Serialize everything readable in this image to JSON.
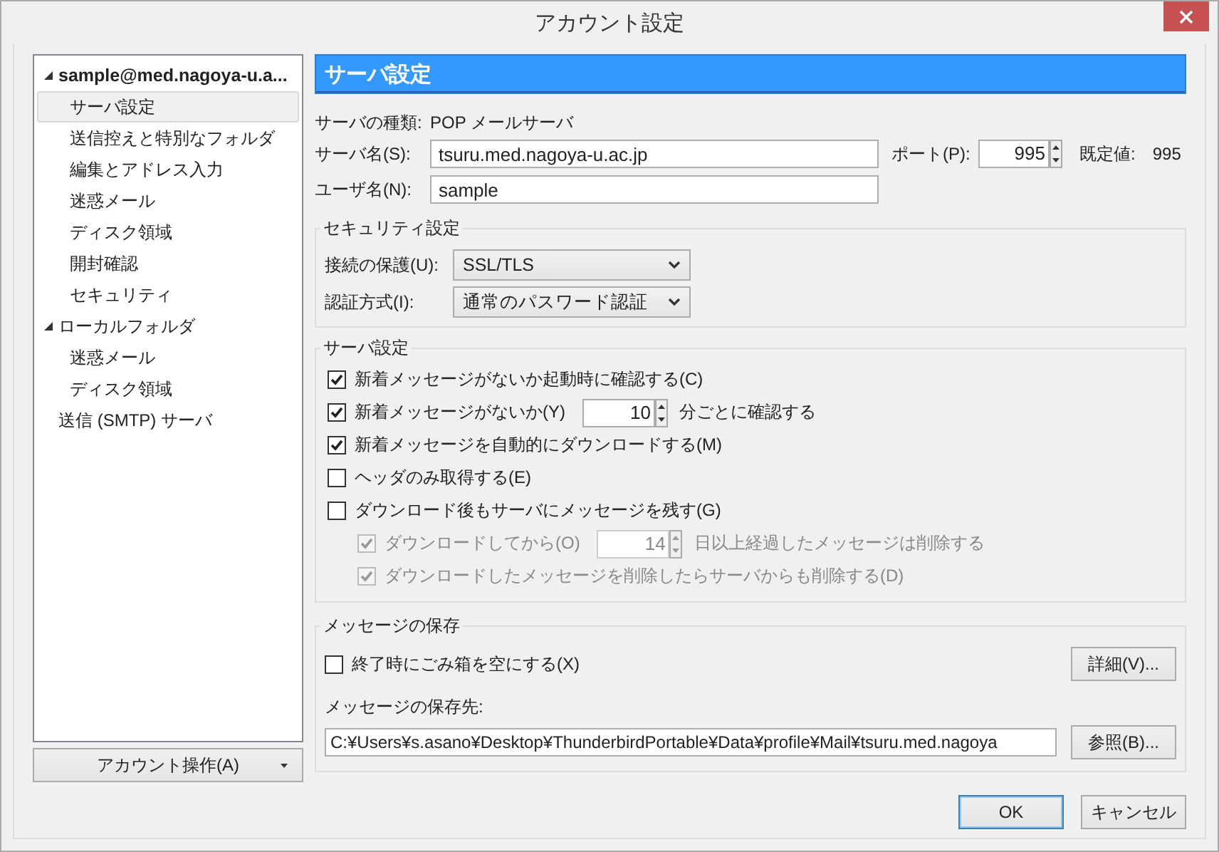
{
  "window": {
    "title": "アカウント設定"
  },
  "tree": [
    {
      "label": "sample@med.nagoya-u.a...",
      "kind": "account",
      "expanded": true,
      "selected": false,
      "children": [
        {
          "label": "サーバ設定",
          "selected": true
        },
        {
          "label": "送信控えと特別なフォルダ",
          "selected": false
        },
        {
          "label": "編集とアドレス入力",
          "selected": false
        },
        {
          "label": "迷惑メール",
          "selected": false
        },
        {
          "label": "ディスク領域",
          "selected": false
        },
        {
          "label": "開封確認",
          "selected": false
        },
        {
          "label": "セキュリティ",
          "selected": false
        }
      ]
    },
    {
      "label": "ローカルフォルダ",
      "kind": "folder",
      "expanded": true,
      "selected": false,
      "children": [
        {
          "label": "迷惑メール",
          "selected": false
        },
        {
          "label": "ディスク領域",
          "selected": false
        }
      ]
    },
    {
      "label": "送信 (SMTP) サーバ",
      "kind": "folder",
      "selected": false
    }
  ],
  "account_actions_button": "アカウント操作(A)",
  "header": "サーバ設定",
  "server_type": {
    "label": "サーバの種類:",
    "value": "POP メールサーバ"
  },
  "server_name": {
    "label": "サーバ名(S):",
    "value": "tsuru.med.nagoya-u.ac.jp"
  },
  "port": {
    "label": "ポート(P):",
    "value": "995",
    "default_label": "既定値:",
    "default_value": "995"
  },
  "user_name": {
    "label": "ユーザ名(N):",
    "value": "sample"
  },
  "security": {
    "title": "セキュリティ設定",
    "fields": [
      {
        "label": "接続の保護(U):",
        "value": "SSL/TLS"
      },
      {
        "label": "認証方式(I):",
        "value": "通常のパスワード認証"
      }
    ]
  },
  "server_settings": {
    "title": "サーバ設定",
    "options": [
      {
        "kind": "check",
        "label": "新着メッセージがないか起動時に確認する(C)",
        "checked": true,
        "disabled": false
      },
      {
        "kind": "spin",
        "label": "新着メッセージがないか(Y)",
        "checked": true,
        "disabled": false,
        "value": "10",
        "suffix": "分ごとに確認する"
      },
      {
        "kind": "check",
        "label": "新着メッセージを自動的にダウンロードする(M)",
        "checked": true,
        "disabled": false
      },
      {
        "kind": "check",
        "label": "ヘッダのみ取得する(E)",
        "checked": false,
        "disabled": false
      },
      {
        "kind": "check",
        "label": "ダウンロード後もサーバにメッセージを残す(G)",
        "checked": false,
        "disabled": false,
        "children": [
          {
            "kind": "spin",
            "label": "ダウンロードしてから(O)",
            "checked": true,
            "disabled": true,
            "value": "14",
            "suffix": "日以上経過したメッセージは削除する"
          },
          {
            "kind": "check",
            "label": "ダウンロードしたメッセージを削除したらサーバからも削除する(D)",
            "checked": true,
            "disabled": true
          }
        ]
      }
    ]
  },
  "message_storage": {
    "title": "メッセージの保存",
    "empty_trash": {
      "label": "終了時にごみ箱を空にする(X)",
      "checked": false
    },
    "advanced_button": "詳細(V)...",
    "path_label": "メッセージの保存先:",
    "path_value": "C:¥Users¥s.asano¥Desktop¥ThunderbirdPortable¥Data¥profile¥Mail¥tsuru.med.nagoya",
    "browse_button": "参照(B)..."
  },
  "buttons": [
    {
      "label": "OK",
      "default": true
    },
    {
      "label": "キャンセル",
      "default": false
    }
  ]
}
